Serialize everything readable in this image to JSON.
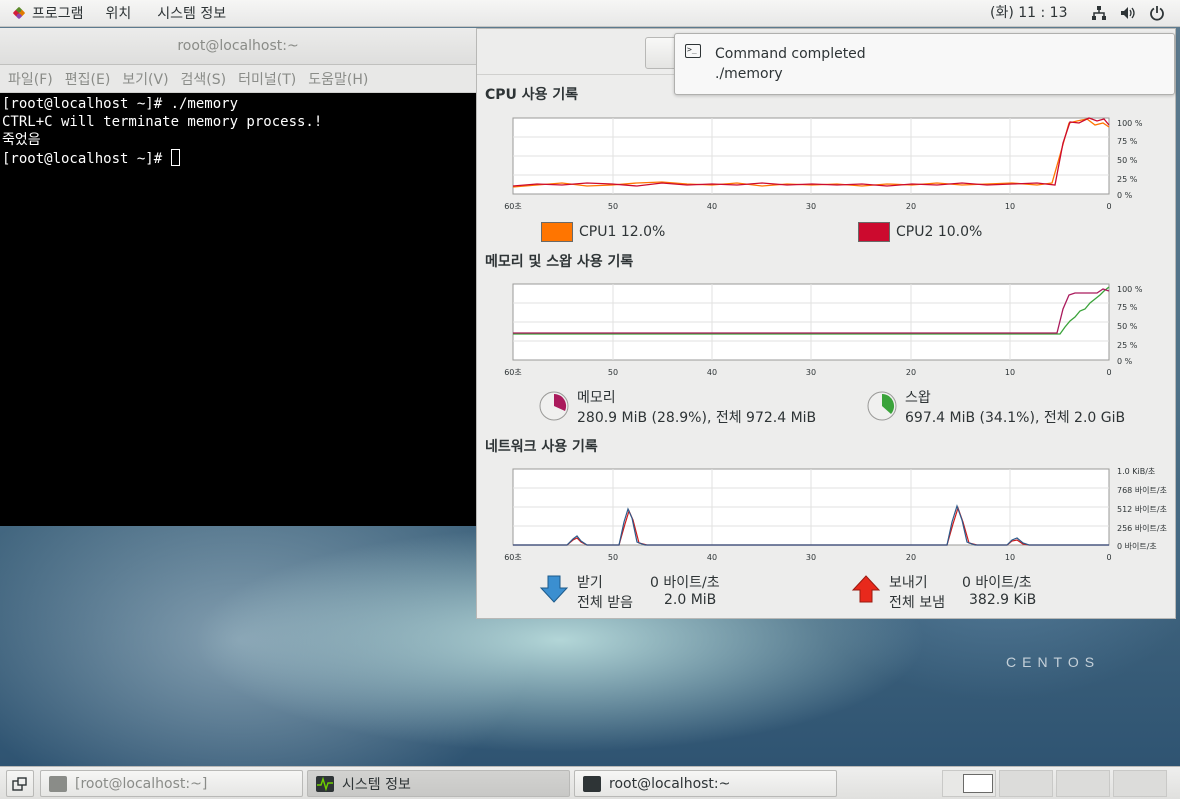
{
  "topbar": {
    "menus": [
      "프로그램",
      "위치",
      "시스템 정보"
    ],
    "clock": "(화) 11 : 13",
    "tray_icons": [
      "network-icon",
      "volume-icon",
      "power-icon"
    ]
  },
  "terminal": {
    "title": "root@localhost:~",
    "menus": [
      "파일(F)",
      "편집(E)",
      "보기(V)",
      "검색(S)",
      "터미널(T)",
      "도움말(H)"
    ],
    "lines": [
      "[root@localhost ~]# ./memory",
      "CTRL+C will terminate memory process.!",
      "죽었음",
      "[root@localhost ~]# "
    ]
  },
  "notification": {
    "title": "Command completed",
    "body": "./memory"
  },
  "sysmon": {
    "x_ticks": [
      "60초",
      "50",
      "40",
      "30",
      "20",
      "10",
      "0"
    ],
    "cpu": {
      "title": "CPU 사용 기록",
      "y_ticks": [
        "100 %",
        "75 %",
        "50 %",
        "25 %",
        "0 %"
      ],
      "legend": [
        {
          "label": "CPU1",
          "value": "12.0%",
          "color": "#ff7500"
        },
        {
          "label": "CPU2",
          "value": "10.0%",
          "color": "#cc0a2e"
        }
      ]
    },
    "memory": {
      "title": "메모리 및 스왑 사용 기록",
      "y_ticks": [
        "100 %",
        "75 %",
        "50 %",
        "25 %",
        "0 %"
      ],
      "mem_label": "메모리",
      "mem_value": "280.9 MiB (28.9%), 전체 972.4 MiB",
      "swap_label": "스왑",
      "swap_value": "697.4 MiB (34.1%), 전체 2.0 GiB",
      "mem_color": "#aa1a5c",
      "swap_color": "#3aa33a"
    },
    "network": {
      "title": "네트워크 사용 기록",
      "y_ticks": [
        "1.0 KiB/초",
        "768 바이트/초",
        "512 바이트/초",
        "256 바이트/초",
        "0 바이트/초"
      ],
      "recv_label": "받기",
      "recv_rate": "0 바이트/초",
      "recv_total_label": "전체 받음",
      "recv_total": "2.0 MiB",
      "send_label": "보내기",
      "send_rate": "0 바이트/초",
      "send_total_label": "전체 보냄",
      "send_total": "382.9 KiB"
    }
  },
  "taskbar": {
    "items": [
      "[root@localhost:~]",
      "시스템 정보",
      "root@localhost:~"
    ]
  },
  "desktop": {
    "logo_text": "CENTOS"
  }
}
